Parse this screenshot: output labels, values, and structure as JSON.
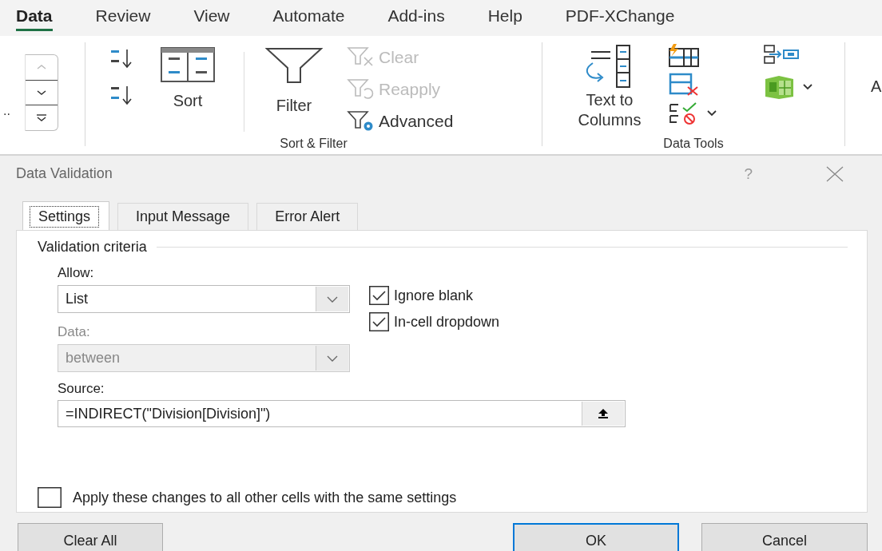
{
  "ribbon_tabs": [
    {
      "label": "Data",
      "selected": true
    },
    {
      "label": "Review",
      "selected": false
    },
    {
      "label": "View",
      "selected": false
    },
    {
      "label": "Automate",
      "selected": false
    },
    {
      "label": "Add-ins",
      "selected": false
    },
    {
      "label": "Help",
      "selected": false
    },
    {
      "label": "PDF-XChange",
      "selected": false
    }
  ],
  "ribbon": {
    "gallery_fragment": "..",
    "sort_filter": {
      "label": "Sort & Filter",
      "sort": "Sort",
      "filter": "Filter",
      "commands": [
        {
          "kind": "clear",
          "label": "Clear",
          "disabled": true
        },
        {
          "kind": "reapply",
          "label": "Reapply",
          "disabled": true
        },
        {
          "kind": "advanced",
          "label": "Advanced",
          "disabled": false
        }
      ]
    },
    "data_tools": {
      "label": "Data Tools",
      "text_to_columns": "Text to Columns"
    },
    "next_group_fragment": "A"
  },
  "dialog": {
    "title": "Data Validation",
    "help": "?",
    "tabs": [
      {
        "label": "Settings",
        "selected": true
      },
      {
        "label": "Input Message",
        "selected": false
      },
      {
        "label": "Error Alert",
        "selected": false
      }
    ],
    "section": "Validation criteria",
    "allow": {
      "label": "Allow:",
      "value": "List",
      "disabled": false
    },
    "data": {
      "label": "Data:",
      "value": "between",
      "disabled": true
    },
    "options": [
      {
        "label": "Ignore blank",
        "checked": true
      },
      {
        "label": "In-cell dropdown",
        "checked": true
      }
    ],
    "source": {
      "label": "Source:",
      "value": "=INDIRECT(\"Division[Division]\")"
    },
    "apply_all": {
      "label": "Apply these changes to all other cells with the same settings",
      "checked": false
    },
    "buttons": [
      {
        "label": "Clear All",
        "default": false
      },
      {
        "label": "OK",
        "default": true
      },
      {
        "label": "Cancel",
        "default": false
      }
    ]
  }
}
